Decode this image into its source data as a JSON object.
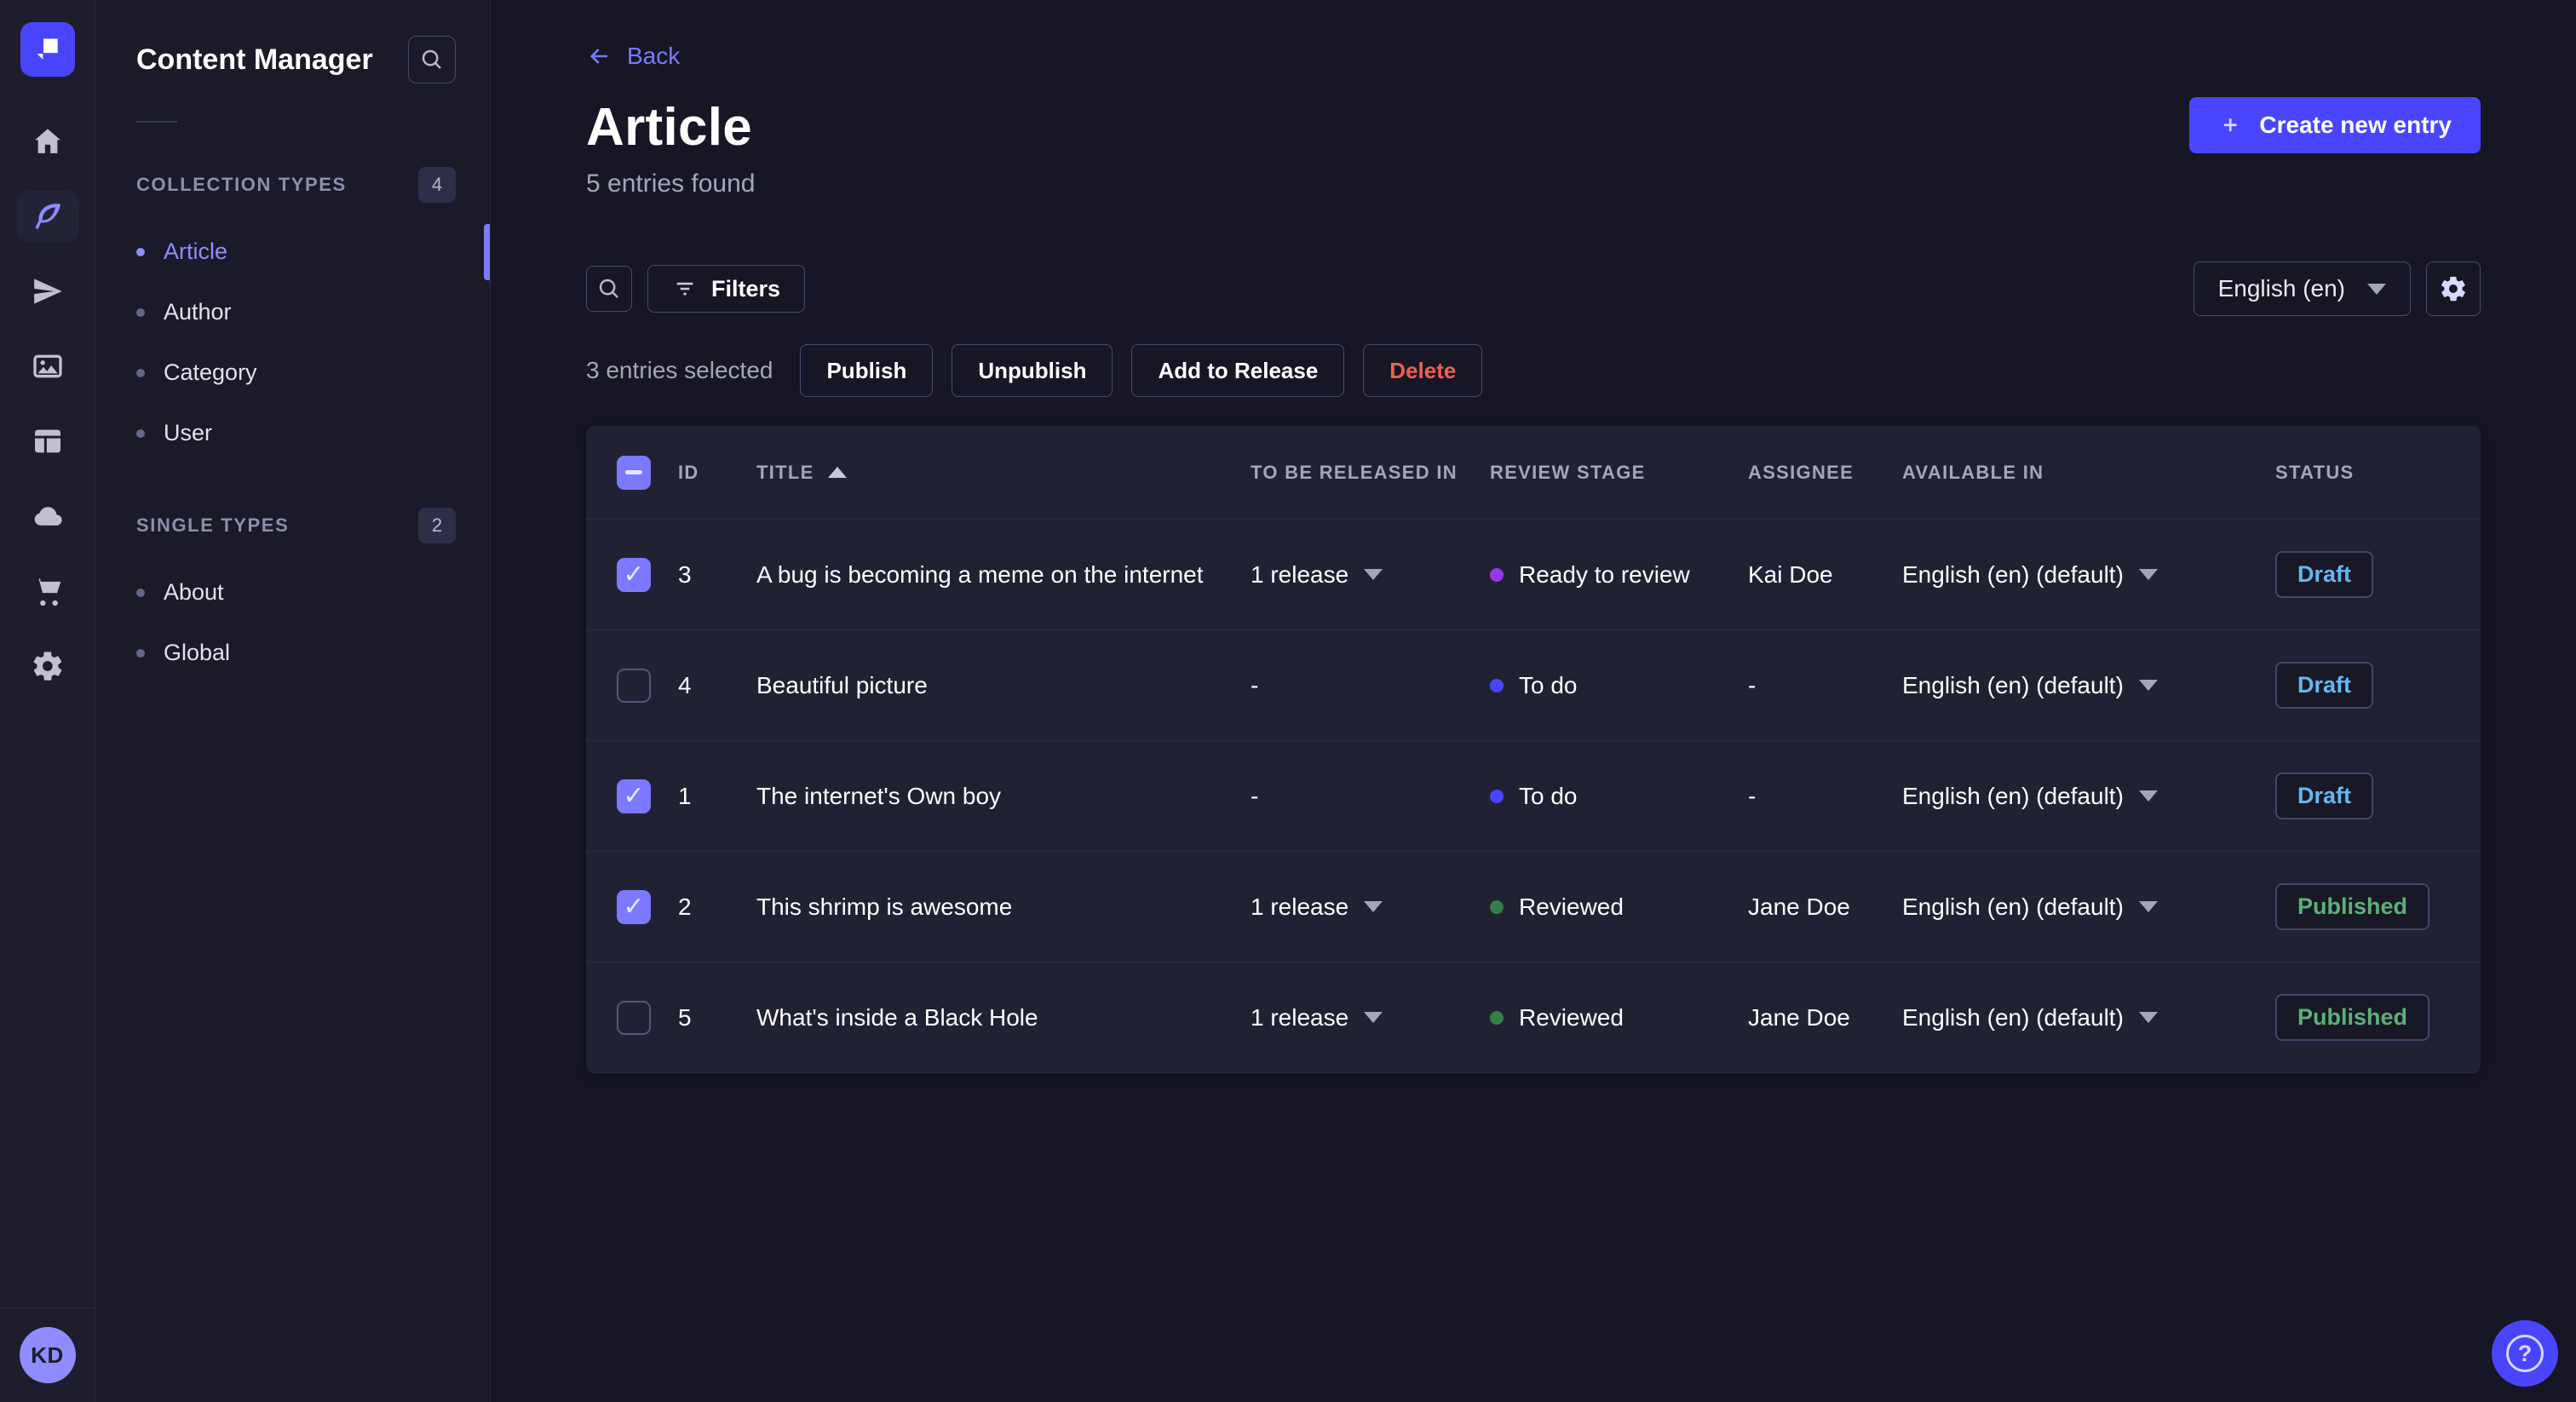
{
  "nav_rail": {
    "icons": [
      "strapi-logo",
      "home-icon",
      "content-manager-icon",
      "releases-icon",
      "media-library-icon",
      "content-type-builder-icon",
      "cloud-icon",
      "marketplace-icon",
      "settings-icon"
    ],
    "active": "content-manager-icon",
    "avatar_initials": "KD"
  },
  "sidebar": {
    "title": "Content Manager",
    "collection_types": {
      "label": "COLLECTION TYPES",
      "count": "4",
      "items": [
        {
          "label": "Article",
          "active": true
        },
        {
          "label": "Author"
        },
        {
          "label": "Category"
        },
        {
          "label": "User"
        }
      ]
    },
    "single_types": {
      "label": "SINGLE TYPES",
      "count": "2",
      "items": [
        {
          "label": "About"
        },
        {
          "label": "Global"
        }
      ]
    }
  },
  "header": {
    "back_label": "Back",
    "title": "Article",
    "subtitle": "5 entries found",
    "create_label": "Create new entry"
  },
  "toolbar": {
    "filters_label": "Filters",
    "locale": "English (en)"
  },
  "selection": {
    "label": "3 entries selected",
    "actions": [
      {
        "label": "Publish"
      },
      {
        "label": "Unpublish"
      },
      {
        "label": "Add to Release"
      },
      {
        "label": "Delete",
        "danger": true
      }
    ]
  },
  "table": {
    "select_all_state": "indeterminate",
    "sort": {
      "column": "TITLE",
      "direction": "ascending"
    },
    "headers": {
      "id": "ID",
      "title": "TITLE",
      "released": "TO BE RELEASED IN",
      "stage": "REVIEW STAGE",
      "assignee": "ASSIGNEE",
      "available": "AVAILABLE IN",
      "status": "STATUS"
    },
    "rows": [
      {
        "checked": true,
        "id": "3",
        "title": "A bug is becoming a meme on the internet",
        "release": "1 release",
        "has_release_menu": true,
        "stage": "Ready to review",
        "stage_color": "#9736e8",
        "assignee": "Kai Doe",
        "locale": "English (en) (default)",
        "status": "Draft",
        "published": false
      },
      {
        "checked": false,
        "id": "4",
        "title": "Beautiful picture",
        "release": "-",
        "has_release_menu": false,
        "stage": "To do",
        "stage_color": "#4945ff",
        "assignee": "-",
        "locale": "English (en) (default)",
        "status": "Draft",
        "published": false
      },
      {
        "checked": true,
        "id": "1",
        "title": "The internet's Own boy",
        "release": "-",
        "has_release_menu": false,
        "stage": "To do",
        "stage_color": "#4945ff",
        "assignee": "-",
        "locale": "English (en) (default)",
        "status": "Draft",
        "published": false
      },
      {
        "checked": true,
        "id": "2",
        "title": "This shrimp is awesome",
        "release": "1 release",
        "has_release_menu": true,
        "stage": "Reviewed",
        "stage_color": "#328048",
        "assignee": "Jane Doe",
        "locale": "English (en) (default)",
        "status": "Published",
        "published": true
      },
      {
        "checked": false,
        "id": "5",
        "title": "What's inside a Black Hole",
        "release": "1 release",
        "has_release_menu": true,
        "stage": "Reviewed",
        "stage_color": "#328048",
        "assignee": "Jane Doe",
        "locale": "English (en) (default)",
        "status": "Published",
        "published": true
      }
    ]
  },
  "colors": {
    "primary": "#4945ff",
    "accent": "#7b79ff",
    "danger": "#ee5e52",
    "draft_text": "#66b7f1",
    "published_text": "#5cb176",
    "stage_todo": "#4945ff",
    "stage_ready_to_review": "#9736e8",
    "stage_reviewed": "#328048"
  }
}
